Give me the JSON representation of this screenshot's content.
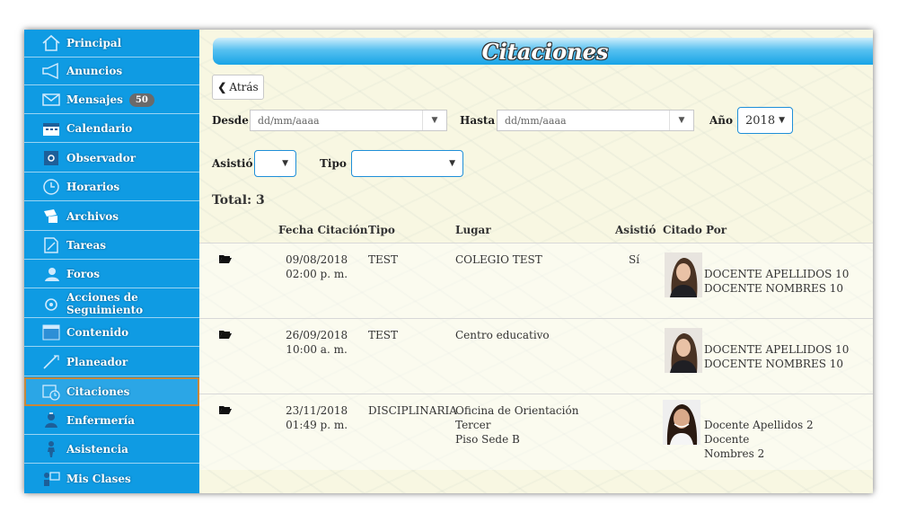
{
  "sidebar": {
    "items": [
      {
        "label": "Principal",
        "icon": "home-icon"
      },
      {
        "label": "Anuncios",
        "icon": "megaphone-icon"
      },
      {
        "label": "Mensajes",
        "icon": "envelope-icon",
        "badge": "50"
      },
      {
        "label": "Calendario",
        "icon": "calendar-icon"
      },
      {
        "label": "Observador",
        "icon": "observer-icon"
      },
      {
        "label": "Horarios",
        "icon": "clock-icon"
      },
      {
        "label": "Archivos",
        "icon": "files-icon"
      },
      {
        "label": "Tareas",
        "icon": "tasks-icon"
      },
      {
        "label": "Foros",
        "icon": "forum-icon"
      },
      {
        "label": "Acciones de Seguimiento",
        "icon": "follow-up-icon"
      },
      {
        "label": "Contenido",
        "icon": "content-icon"
      },
      {
        "label": "Planeador",
        "icon": "planner-icon"
      },
      {
        "label": "Citaciones",
        "icon": "citation-calendar-icon",
        "active": true
      },
      {
        "label": "Enfermería",
        "icon": "nurse-icon"
      },
      {
        "label": "Asistencia",
        "icon": "attendance-icon"
      },
      {
        "label": "Mis Clases",
        "icon": "classes-icon"
      }
    ]
  },
  "page": {
    "title": "Citaciones"
  },
  "toolbar": {
    "back_label": "Atrás"
  },
  "filters": {
    "desde_label": "Desde",
    "desde_placeholder": "dd/mm/aaaa",
    "hasta_label": "Hasta",
    "hasta_placeholder": "dd/mm/aaaa",
    "anio_label": "Año",
    "anio_value": "2018",
    "asistio_label": "Asistió",
    "asistio_value": "",
    "tipo_label": "Tipo",
    "tipo_value": ""
  },
  "total_label": "Total: 3",
  "table": {
    "headers": {
      "fecha": "Fecha Citación",
      "tipo": "Tipo",
      "lugar": "Lugar",
      "asistio": "Asistió",
      "citado": "Citado Por"
    },
    "rows": [
      {
        "date": "09/08/2018",
        "time": "02:00 p. m.",
        "tipo": "TEST",
        "lugar_1": "COLEGIO TEST",
        "lugar_2": "",
        "asistio": "Sí",
        "citado_1": "DOCENTE APELLIDOS 10",
        "citado_2": "DOCENTE NOMBRES 10"
      },
      {
        "date": "26/09/2018",
        "time": "10:00 a. m.",
        "tipo": "TEST",
        "lugar_1": "Centro educativo",
        "lugar_2": "",
        "asistio": "",
        "citado_1": "DOCENTE APELLIDOS 10",
        "citado_2": "DOCENTE NOMBRES 10"
      },
      {
        "date": "23/11/2018",
        "time": "01:49 p. m.",
        "tipo": "DISCIPLINARIA",
        "lugar_1": "Oficina de Orientación Tercer",
        "lugar_2": "Piso Sede B",
        "asistio": "",
        "citado_1": "Docente Apellidos 2 Docente",
        "citado_2": "Nombres 2"
      }
    ]
  },
  "colors": {
    "sidebar": "#0f9be3",
    "accent": "#18a4e6",
    "background": "#f8f7e2",
    "active_border": "#c8873a"
  }
}
